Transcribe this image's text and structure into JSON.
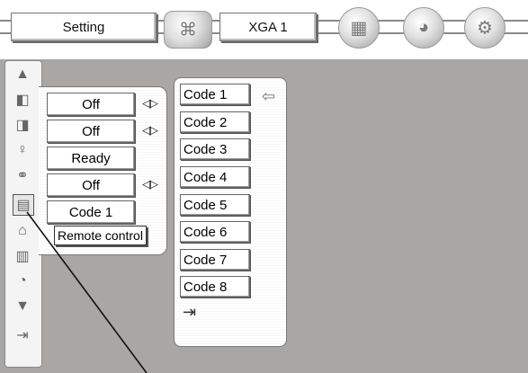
{
  "topbar": {
    "menu_label": "Setting",
    "input_label": "XGA 1"
  },
  "settings": {
    "values": [
      "Off",
      "Off",
      "Ready",
      "Off",
      "Code 1"
    ],
    "tooltip": "Remote control"
  },
  "codes": {
    "items": [
      "Code 1",
      "Code 2",
      "Code 3",
      "Code 4",
      "Code 5",
      "Code 6",
      "Code 7",
      "Code 8"
    ],
    "selected": "Code 1"
  },
  "icons": {
    "left": [
      "up-arrow-icon",
      "keystone-icon",
      "ceiling-icon",
      "lamp-icon",
      "power-management-icon",
      "remote-control-icon",
      "security-icon",
      "filter-icon",
      "screen-icon",
      "down-arrow-icon",
      "exit-icon"
    ]
  }
}
